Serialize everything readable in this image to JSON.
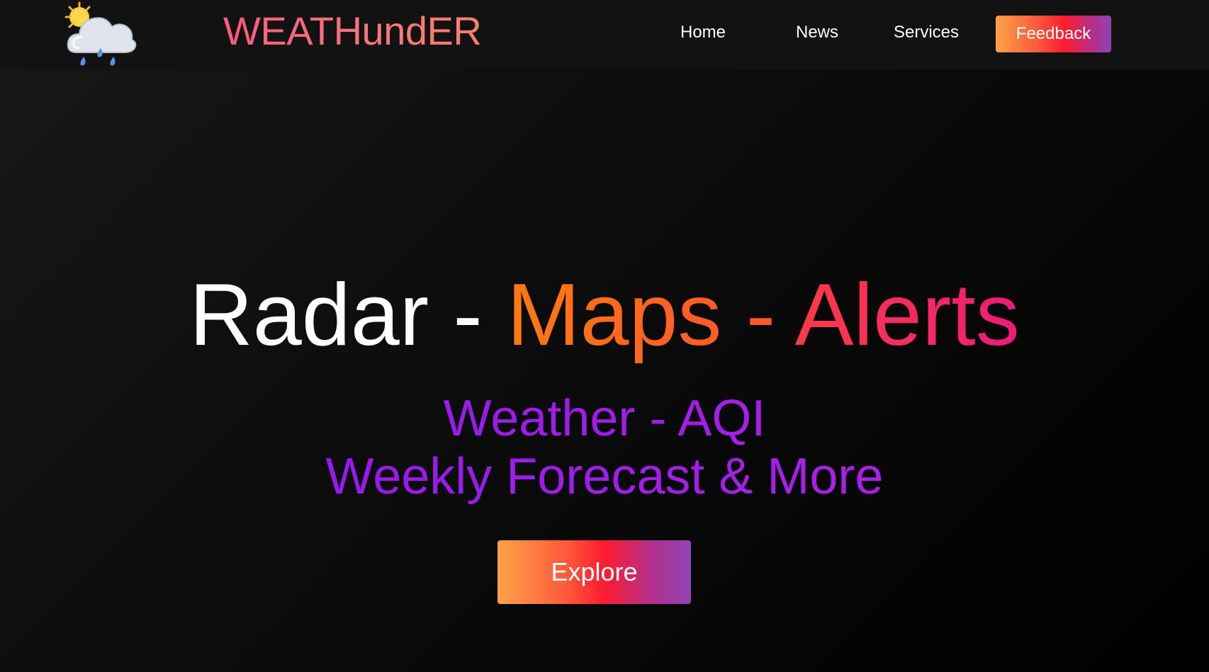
{
  "header": {
    "logo_icon": "sun-behind-rain-cloud-icon",
    "brand": "WEATHundER",
    "nav": [
      {
        "label": "Home"
      },
      {
        "label": "News"
      },
      {
        "label": "Services"
      }
    ],
    "feedback_label": "Feedback"
  },
  "hero": {
    "title": {
      "part1": "Radar",
      "sep1": " - ",
      "part2": "Maps",
      "sep2": " - ",
      "part3": "Alerts"
    },
    "subtitle_line1": "Weather - AQI",
    "subtitle_line2": "Weekly Forecast & More",
    "cta_label": "Explore"
  },
  "colors": {
    "background": "#000000",
    "navbar": "#121212",
    "brand": "#f56d74",
    "accent_orange": "#ff7a10",
    "accent_pink": "#ec1b78",
    "subtitle_purple": "#9a1cec",
    "button_gradient": [
      "#fca347",
      "#fd1c2f",
      "#8e45b3"
    ]
  }
}
